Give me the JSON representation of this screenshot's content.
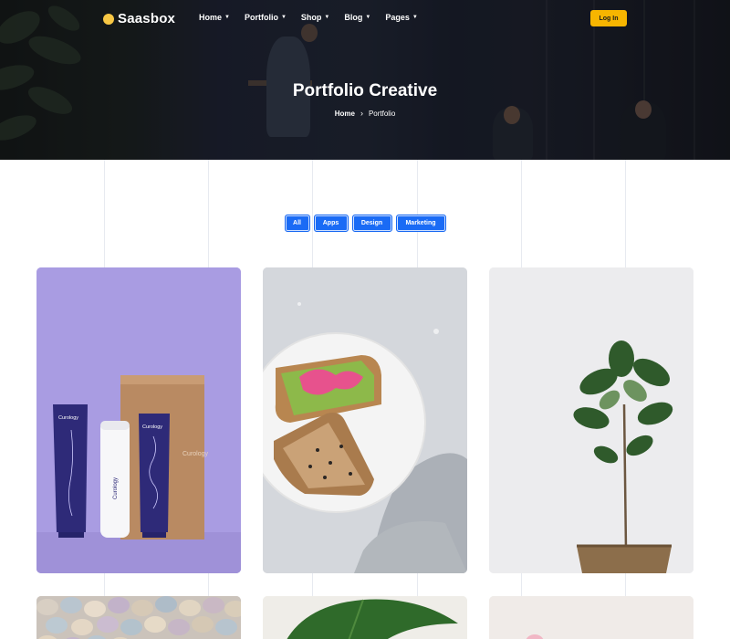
{
  "brand": {
    "name": "Saasbox",
    "accent": "#f7c744"
  },
  "nav": {
    "items": [
      {
        "label": "Home"
      },
      {
        "label": "Portfolio"
      },
      {
        "label": "Shop"
      },
      {
        "label": "Blog"
      },
      {
        "label": "Pages"
      }
    ],
    "login_label": "Log In"
  },
  "hero": {
    "title": "Portfolio Creative",
    "breadcrumb": {
      "home": "Home",
      "current": "Portfolio",
      "separator_icon": "chevron-right-icon"
    }
  },
  "filters": {
    "items": [
      {
        "label": "All"
      },
      {
        "label": "Apps"
      },
      {
        "label": "Design"
      },
      {
        "label": "Marketing"
      }
    ],
    "color": "#1a6bf5"
  },
  "portfolio": {
    "items": [
      {
        "image": "skincare-products-photo",
        "brand_text": "Curology",
        "tube_text": "Curology",
        "bottle_text": "Curology"
      },
      {
        "image": "avocado-toast-photo"
      },
      {
        "image": "fiddle-leaf-plant-photo"
      },
      {
        "image": "pastel-eggs-photo"
      },
      {
        "image": "monstera-leaf-photo"
      },
      {
        "image": "pink-object-photo"
      }
    ]
  }
}
